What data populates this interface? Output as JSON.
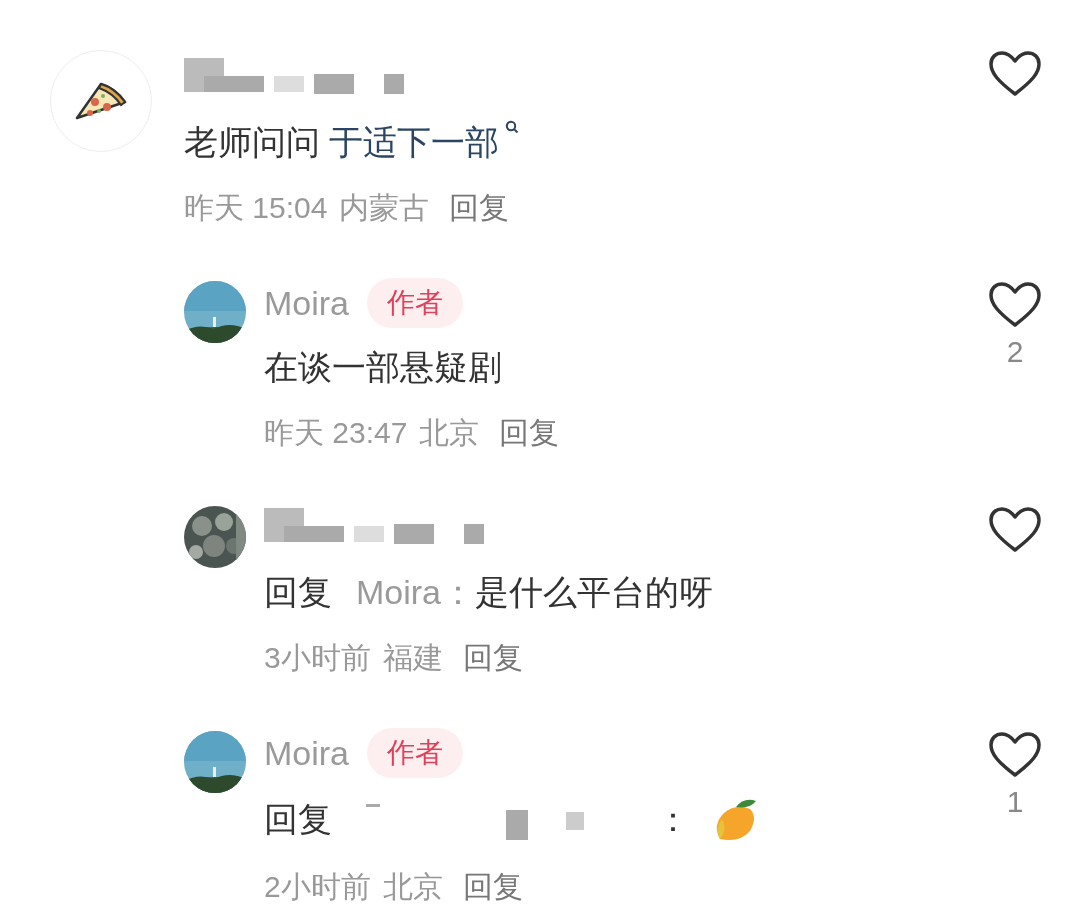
{
  "comments": [
    {
      "name_hidden": true,
      "text": [
        {
          "kind": "plain",
          "text": "老师问问 "
        },
        {
          "kind": "topic",
          "text": "于适下一部"
        }
      ],
      "time": "昨天 15:04",
      "place": "内蒙古",
      "reply": "回复",
      "children": [
        {
          "name": "Moira",
          "badge": "作者",
          "text": [
            {
              "kind": "plain",
              "text": "在谈一部悬疑剧"
            }
          ],
          "time": "昨天 23:47",
          "place": "北京",
          "reply": "回复",
          "likes": "2"
        },
        {
          "name_hidden": true,
          "reply_label": "回复",
          "mention": "Moira：",
          "text": [
            {
              "kind": "plain",
              "text": "是什么平台的呀"
            }
          ],
          "time": "3小时前",
          "place": "福建",
          "reply": "回复"
        },
        {
          "name": "Moira",
          "badge": "作者",
          "reply_label": "回复",
          "mention_hidden": true,
          "colon": "：",
          "sticker": true,
          "time": "2小时前",
          "place": "北京",
          "reply": "回复",
          "likes": "1"
        }
      ]
    }
  ]
}
